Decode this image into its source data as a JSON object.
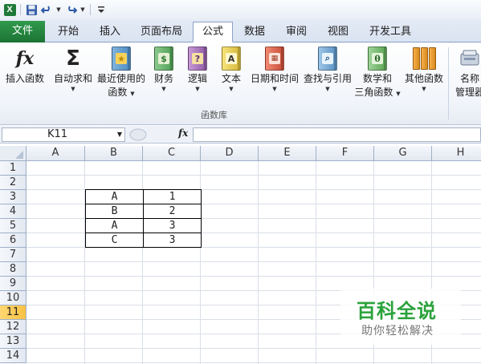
{
  "qat": {
    "icons": [
      "excel-logo",
      "save-icon",
      "undo-icon",
      "redo-icon",
      "customize-icon"
    ]
  },
  "tabs": {
    "file": "文件",
    "items": [
      "开始",
      "插入",
      "页面布局",
      "公式",
      "数据",
      "审阅",
      "视图",
      "开发工具"
    ],
    "active": "公式"
  },
  "ribbon": {
    "insert_function": "插入函数",
    "autosum": "自动求和",
    "recent_line1": "最近使用的",
    "recent_line2": "函数",
    "financial": "财务",
    "logical": "逻辑",
    "text": "文本",
    "datetime": "日期和时间",
    "lookup": "查找与引用",
    "math_line1": "数学和",
    "math_line2": "三角函数",
    "other": "其他函数",
    "name_mgr_line1": "名称",
    "name_mgr_line2": "管理器",
    "group_label": "函数库"
  },
  "formula_bar": {
    "name_box": "K11",
    "fx": "fx",
    "value": ""
  },
  "grid": {
    "columns": [
      "A",
      "B",
      "C",
      "D",
      "E",
      "F",
      "G",
      "H"
    ],
    "rows": [
      "1",
      "2",
      "3",
      "4",
      "5",
      "6",
      "7",
      "8",
      "9",
      "10",
      "11",
      "12",
      "13",
      "14"
    ],
    "selected_row": "11",
    "table": [
      [
        "A",
        "1"
      ],
      [
        "B",
        "2"
      ],
      [
        "A",
        "3"
      ],
      [
        "C",
        "3"
      ]
    ]
  },
  "watermark": {
    "line1": "百科全说",
    "line2": "助你轻松解决"
  },
  "colors": {
    "file_tab": "#1c7334",
    "selected_header": "#f6c144",
    "watermark_green": "#2aa23b"
  }
}
